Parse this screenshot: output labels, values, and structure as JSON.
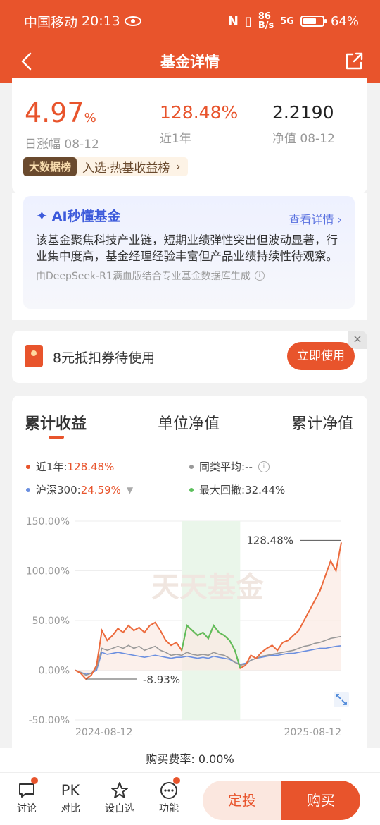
{
  "status_bar": {
    "carrier": "中国移动",
    "time": "20:13",
    "net_speed": "86\nB/s",
    "net_type": "5G",
    "battery": "64%"
  },
  "nav": {
    "title": "基金详情"
  },
  "stats": {
    "daily_change": {
      "value": "4.97",
      "unit": "%",
      "label": "日涨幅 08-12"
    },
    "one_year": {
      "value": "128.48%",
      "label": "近1年"
    },
    "nav": {
      "value": "2.2190",
      "label": "净值 08-12"
    }
  },
  "badge": {
    "tag": "大数据榜",
    "text": "入选·热基收益榜"
  },
  "ai": {
    "title": "AI秒懂基金",
    "more": "查看详情",
    "body": "该基金聚焦科技产业链，短期业绩弹性突出但波动显著，行业集中度高，基金经理经验丰富但产品业绩持续性待观察。",
    "source": "由DeepSeek-R1满血版结合专业基金数据库生成"
  },
  "coupon": {
    "text": "8元抵扣券待使用",
    "button": "立即使用",
    "close": "×"
  },
  "chart_tabs": [
    "累计收益",
    "单位净值",
    "累计净值"
  ],
  "legend": {
    "fund": {
      "label": "近1年:",
      "value": "128.48%"
    },
    "peer": {
      "label": "同类平均:",
      "value": "--"
    },
    "index": {
      "label": "沪深300:",
      "value": "24.59%"
    },
    "drawdown": {
      "label": "最大回撤:",
      "value": "32.44%"
    }
  },
  "colors": {
    "accent": "#e8542c",
    "fund_line": "#ec6a3c",
    "peer_line": "#999999",
    "index_line": "#6b8fe0",
    "drawdown_line": "#5cc05c"
  },
  "chart_data": {
    "type": "line",
    "y_ticks": [
      "150.00%",
      "100.00%",
      "50.00%",
      "0.00%",
      "-50.00%"
    ],
    "ylim": [
      -50,
      150
    ],
    "x_labels": [
      "2024-08-12",
      "2025-08-12"
    ],
    "annotations": {
      "max": "128.48%",
      "min": "-8.93%"
    },
    "watermark": "天天基金",
    "series": [
      {
        "name": "近1年",
        "values": [
          0,
          -3,
          -8.9,
          -5,
          5,
          40,
          30,
          35,
          42,
          38,
          45,
          40,
          43,
          38,
          45,
          48,
          40,
          30,
          25,
          28,
          20,
          45,
          40,
          35,
          38,
          32,
          45,
          38,
          35,
          30,
          20,
          2,
          5,
          15,
          12,
          18,
          22,
          25,
          20,
          28,
          30,
          35,
          40,
          50,
          60,
          70,
          80,
          95,
          110,
          100,
          128.5
        ]
      },
      {
        "name": "同类平均",
        "values": [
          0,
          -2,
          -5,
          -3,
          2,
          22,
          20,
          22,
          24,
          22,
          25,
          22,
          24,
          20,
          22,
          24,
          20,
          18,
          15,
          16,
          15,
          18,
          16,
          15,
          16,
          15,
          18,
          16,
          15,
          12,
          8,
          5,
          6,
          10,
          12,
          14,
          15,
          16,
          17,
          18,
          19,
          20,
          22,
          24,
          25,
          27,
          28,
          30,
          32,
          33,
          34
        ]
      },
      {
        "name": "沪深300",
        "values": [
          0,
          -2,
          -4,
          -3,
          0,
          18,
          16,
          17,
          18,
          17,
          16,
          15,
          14,
          13,
          14,
          15,
          14,
          13,
          12,
          13,
          13,
          14,
          13,
          12,
          13,
          12,
          14,
          13,
          12,
          11,
          8,
          6,
          7,
          10,
          12,
          13,
          14,
          15,
          15,
          16,
          17,
          17,
          18,
          19,
          20,
          21,
          22,
          22,
          23,
          24,
          24.6
        ]
      }
    ],
    "drawdown_range": [
      20,
      31
    ]
  },
  "footer": {
    "fee": "购买费率: 0.00%",
    "tabs": [
      {
        "icon": "💬",
        "label": "讨论"
      },
      {
        "icon": "PK",
        "label": "对比"
      },
      {
        "icon": "☆",
        "label": "设自选"
      },
      {
        "icon": "⋯",
        "label": "功能"
      }
    ],
    "dingtou": "定投",
    "buy": "购买"
  }
}
